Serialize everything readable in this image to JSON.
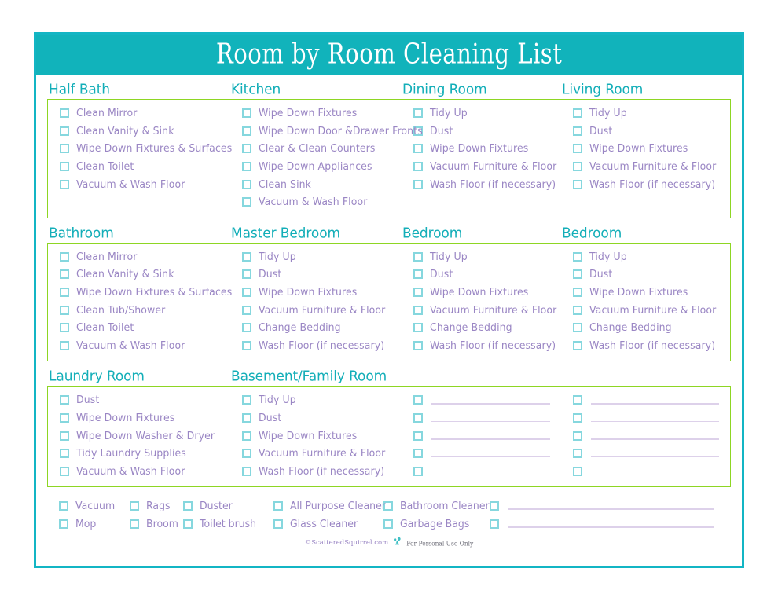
{
  "title": "Room by Room Cleaning List",
  "colors": {
    "banner": "#11b3bb",
    "border": "#13b5c4",
    "section_border": "#8ed623",
    "heading": "#13aeb8",
    "item_text": "#9a86c4",
    "checkbox": "#86d7de",
    "rule": "#ddd1ea"
  },
  "bands": [
    {
      "columns": [
        {
          "heading": "Half Bath",
          "items": [
            "Clean Mirror",
            "Clean Vanity & Sink",
            "Wipe Down Fixtures & Surfaces",
            "Clean Toilet",
            "Vacuum & Wash Floor"
          ]
        },
        {
          "heading": "Kitchen",
          "items": [
            "Wipe Down Fixtures",
            "Wipe Down Door &Drawer Fronts",
            "Clear & Clean Counters",
            "Wipe Down Appliances",
            "Clean Sink",
            "Vacuum & Wash Floor"
          ]
        },
        {
          "heading": "Dining Room",
          "items": [
            "Tidy Up",
            "Dust",
            "Wipe Down Fixtures",
            "Vacuum Furniture & Floor",
            "Wash Floor (if necessary)"
          ]
        },
        {
          "heading": "Living Room",
          "items": [
            "Tidy Up",
            "Dust",
            "Wipe Down Fixtures",
            "Vacuum Furniture & Floor",
            "Wash Floor (if necessary)"
          ]
        }
      ]
    },
    {
      "columns": [
        {
          "heading": "Bathroom",
          "items": [
            "Clean Mirror",
            "Clean Vanity & Sink",
            "Wipe Down Fixtures & Surfaces",
            "Clean Tub/Shower",
            "Clean Toilet",
            "Vacuum & Wash Floor"
          ]
        },
        {
          "heading": "Master Bedroom",
          "items": [
            "Tidy Up",
            "Dust",
            "Wipe Down Fixtures",
            "Vacuum Furniture & Floor",
            "Change Bedding",
            "Wash Floor (if necessary)"
          ]
        },
        {
          "heading": "Bedroom",
          "items": [
            "Tidy Up",
            "Dust",
            "Wipe Down Fixtures",
            "Vacuum Furniture & Floor",
            "Change Bedding",
            "Wash Floor (if necessary)"
          ]
        },
        {
          "heading": "Bedroom",
          "items": [
            "Tidy Up",
            "Dust",
            "Wipe Down Fixtures",
            "Vacuum Furniture & Floor",
            "Change Bedding",
            "Wash Floor (if necessary)"
          ]
        }
      ]
    },
    {
      "columns": [
        {
          "heading": "Laundry Room",
          "items": [
            "Dust",
            "Wipe Down Fixtures",
            "Wipe Down Washer & Dryer",
            "Tidy Laundry Supplies",
            "Vacuum & Wash Floor"
          ]
        },
        {
          "heading": "Basement/Family Room",
          "items": [
            "Tidy Up",
            "Dust",
            "Wipe Down Fixtures",
            "Vacuum Furniture & Floor",
            "Wash Floor (if necessary)"
          ]
        },
        {
          "heading": "",
          "blank_items": 5
        },
        {
          "heading": "",
          "blank_items": 5
        }
      ]
    }
  ],
  "supplies": {
    "columns": [
      {
        "items": [
          "Vacuum",
          "Mop"
        ]
      },
      {
        "items": [
          "Rags",
          "Broom"
        ]
      },
      {
        "items": [
          "Duster",
          "Toilet brush"
        ]
      },
      {
        "items": [
          "All Purpose Cleaner",
          "Glass Cleaner"
        ]
      },
      {
        "items": [
          "Bathroom Cleaner",
          "Garbage Bags"
        ]
      },
      {
        "blank_items": 2
      }
    ]
  },
  "credit": {
    "site": "©ScatteredSquirrel.com",
    "usage": "For Personal Use Only"
  }
}
